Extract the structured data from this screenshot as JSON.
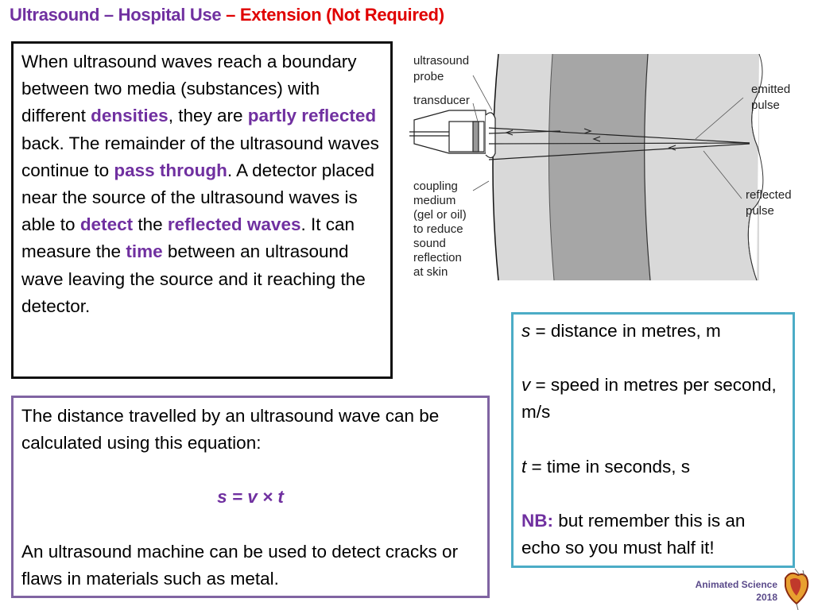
{
  "title": {
    "part1": "Ultrasound – Hospital Use",
    "part2": " – Extension (Not Required)"
  },
  "colors": {
    "purple": "#7030a0",
    "red": "#e00000",
    "box2_border": "#8064a2",
    "box3_border": "#4bacc6"
  },
  "intro_box": {
    "segments": [
      {
        "t": "When ultrasound waves reach a boundary between two media (substances) with different ",
        "hl": false
      },
      {
        "t": "densities",
        "hl": true
      },
      {
        "t": ", they are ",
        "hl": false
      },
      {
        "t": "partly reflected",
        "hl": true
      },
      {
        "t": " back.  The remainder of the ultrasound waves continue to ",
        "hl": false
      },
      {
        "t": "pass through",
        "hl": true
      },
      {
        "t": ". A detector placed near the source of the ultrasound waves is able to ",
        "hl": false
      },
      {
        "t": "detect",
        "hl": true
      },
      {
        "t": " the ",
        "hl": false
      },
      {
        "t": "reflected waves",
        "hl": true
      },
      {
        "t": ". It can measure the ",
        "hl": false
      },
      {
        "t": "time",
        "hl": true
      },
      {
        "t": " between an ultrasound wave leaving the source and it reaching the detector.",
        "hl": false
      }
    ]
  },
  "equation_box": {
    "line1": "The distance travelled by an ultrasound wave can be calculated using this equation:",
    "equation": "s = v × t",
    "line2": "An ultrasound machine can be used to detect cracks or flaws in materials such as metal."
  },
  "variables_box": {
    "s_sym": "s",
    "s_text": " = distance in metres, m",
    "v_sym": "v",
    "v_text": " = speed in metres per second, m/s",
    "t_sym": "t",
    "t_text": " = time in seconds, s",
    "nb_label": "NB:",
    "nb_text": " but remember this is an echo so you must half it!"
  },
  "diagram": {
    "labels": {
      "probe1": "ultrasound",
      "probe2": "probe",
      "transducer": "transducer",
      "coupling1": "coupling",
      "coupling2": "medium",
      "coupling3": "(gel or oil)",
      "coupling4": "to reduce",
      "coupling5": "sound",
      "coupling6": "reflection",
      "coupling7": "at skin",
      "emitted1": "emitted",
      "emitted2": "pulse",
      "reflected1": "reflected",
      "reflected2": "pulse"
    }
  },
  "footer": {
    "brand": "Animated Science",
    "year": "2018"
  }
}
